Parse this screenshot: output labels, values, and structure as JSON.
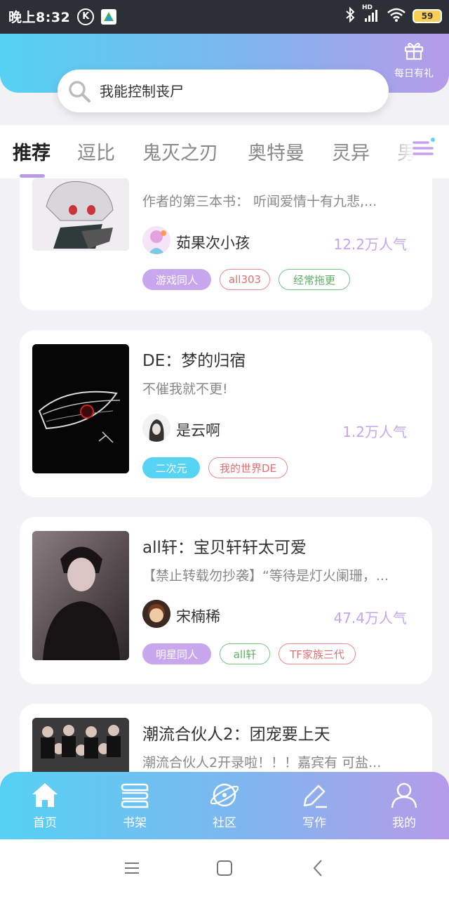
{
  "status_bar": {
    "time": "晚上8:32",
    "k_badge": "K",
    "network": "HD",
    "battery": "59"
  },
  "header": {
    "gift_label": "每日有礼",
    "search_placeholder": "我能控制丧尸"
  },
  "tabs": [
    "推荐",
    "逗比",
    "鬼灭之刃",
    "奥特曼",
    "灵异",
    "男赛"
  ],
  "active_tab": 0,
  "books": [
    {
      "title": "",
      "desc": "作者的第三本书： 听闻爱情十有九悲,...",
      "author": "茹果次小孩",
      "popularity": "12.2万人气",
      "tags": [
        "游戏同人",
        "all303",
        "经常拖更"
      ]
    },
    {
      "title": "DE：梦的归宿",
      "desc": "不催我就不更!",
      "author": "是云啊",
      "popularity": "1.2万人气",
      "tags": [
        "二次元",
        "我的世界DE"
      ]
    },
    {
      "title": "all轩：宝贝轩轩太可爱",
      "desc": "【禁止转载勿抄袭】“等待是灯火阑珊，...",
      "author": "宋楠稀",
      "popularity": "47.4万人气",
      "tags": [
        "明星同人",
        "all轩",
        "TF家族三代"
      ]
    },
    {
      "title": "潮流合伙人2：团宠要上天",
      "desc": "潮流合伙人2开录啦！！！嘉宾有 可盐...",
      "author": "",
      "popularity": "",
      "tags": []
    }
  ],
  "bottom_nav": [
    "首页",
    "书架",
    "社区",
    "写作",
    "我的"
  ],
  "colors": {
    "gradient_start": "#55d1f3",
    "gradient_end": "#b79be8",
    "popularity": "#c2a7ee"
  }
}
